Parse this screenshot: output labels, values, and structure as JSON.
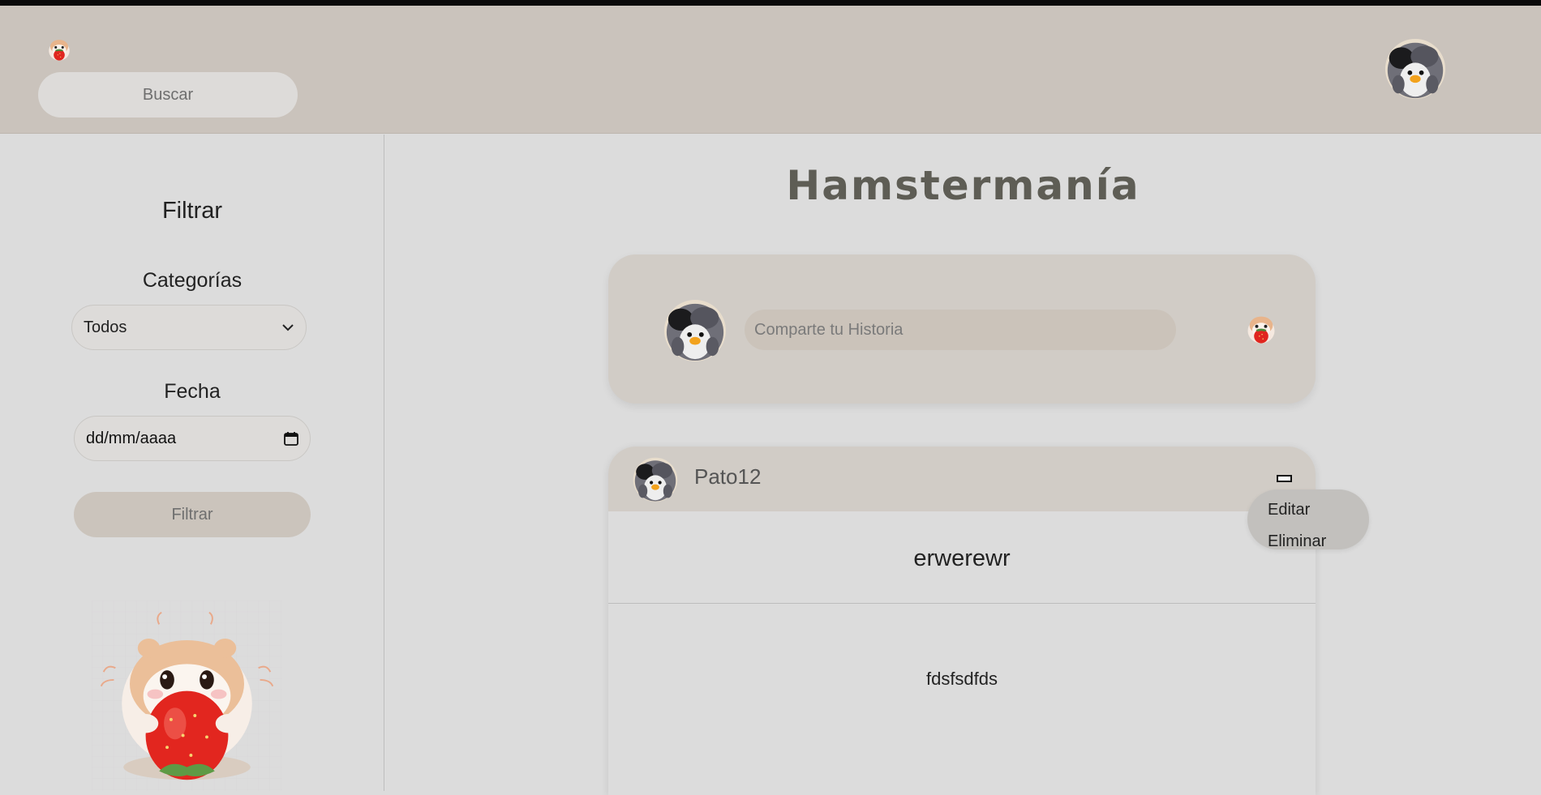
{
  "header": {
    "logo_icon": "hamster-strawberry-icon",
    "search_placeholder": "Buscar",
    "profile_icon": "penguin-avatar-icon"
  },
  "sidebar": {
    "title": "Filtrar",
    "categories_label": "Categorías",
    "category_selected": "Todos",
    "date_label": "Fecha",
    "date_placeholder": "dd/mm/aaaa",
    "filter_button": "Filtrar",
    "illustration": "hamster-strawberry-illustration"
  },
  "main": {
    "title": "Hamstermanía",
    "composer": {
      "placeholder": "Comparte tu Historia",
      "avatar_icon": "penguin-avatar-icon",
      "submit_icon": "hamster-strawberry-icon"
    },
    "post": {
      "username": "Pato12",
      "title": "erwerewr",
      "body": "fdsfsdfds",
      "menu": {
        "edit": "Editar",
        "delete": "Eliminar"
      }
    }
  },
  "colors": {
    "header_bg": "#cac3bc",
    "page_bg": "#dcdcdc",
    "title_color": "#5e5d55",
    "input_bg": "#dddbd9",
    "accent_button": "#cbc4bc"
  }
}
